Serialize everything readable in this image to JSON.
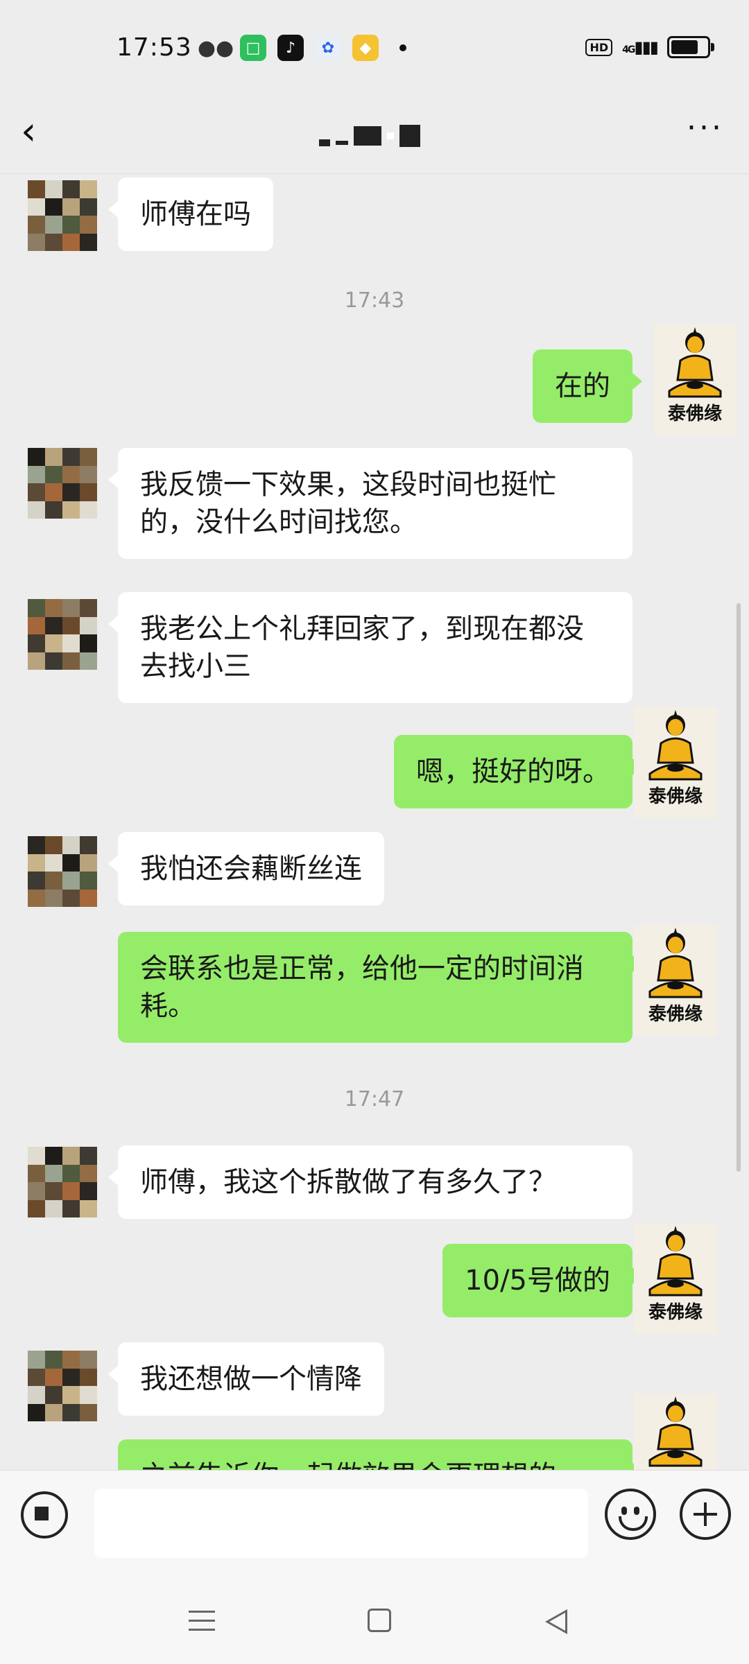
{
  "status_bar": {
    "time": "17:53",
    "network": "4G",
    "hd": "HD",
    "icons": [
      "wechat-icon",
      "app-store-icon",
      "tiktok-icon",
      "baidu-icon",
      "coupon-icon"
    ]
  },
  "header": {
    "title": "",
    "back_icon": "back-arrow-icon",
    "more_icon": "more-dots-icon"
  },
  "contact_avatar_caption": "泰佛缘",
  "messages": [
    {
      "side": "left",
      "text": "师傅在吗"
    },
    {
      "timestamp": "17:43"
    },
    {
      "side": "right",
      "text": "在的"
    },
    {
      "side": "left",
      "text": "我反馈一下效果，这段时间也挺忙的，没什么时间找您。"
    },
    {
      "side": "left",
      "text": "我老公上个礼拜回家了，到现在都没去找小三"
    },
    {
      "side": "right",
      "text": "嗯，挺好的呀。"
    },
    {
      "side": "left",
      "text": "我怕还会藕断丝连"
    },
    {
      "side": "right",
      "text": "会联系也是正常，给他一定的时间消耗。"
    },
    {
      "timestamp": "17:47"
    },
    {
      "side": "left",
      "text": "师傅，我这个拆散做了有多久了？"
    },
    {
      "side": "right",
      "text": "10/5号做的"
    },
    {
      "side": "left",
      "text": "我还想做一个情降"
    },
    {
      "side": "right",
      "text": "之前告诉你一起做效果会更理想的"
    }
  ],
  "input_bar": {
    "voice_icon": "voice-icon",
    "emoji_icon": "emoji-icon",
    "plus_icon": "plus-icon",
    "input_value": ""
  },
  "nav_bar": {
    "icons": [
      "menu-icon",
      "home-icon",
      "back-triangle-icon"
    ]
  }
}
